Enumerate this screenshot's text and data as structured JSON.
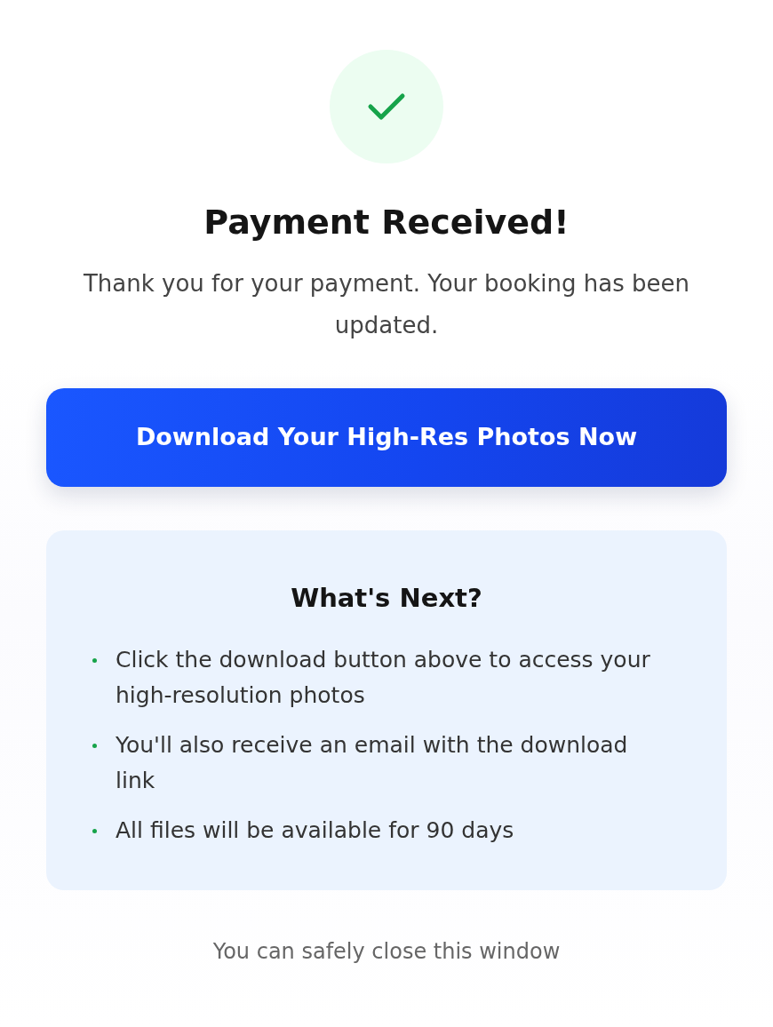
{
  "status_icon": {
    "kind": "success"
  },
  "title": "Payment Received!",
  "message": "Thank you for your payment. Your booking has been updated.",
  "download_button": {
    "label": "Download Your High-Res Photos Now"
  },
  "next_steps": {
    "heading": "What's Next?",
    "items": [
      "Click the download button above to access your high-resolution photos",
      "You'll also receive an email with the download link",
      "All files will be available for 90 days"
    ]
  },
  "footer_note": "You can safely close this window"
}
